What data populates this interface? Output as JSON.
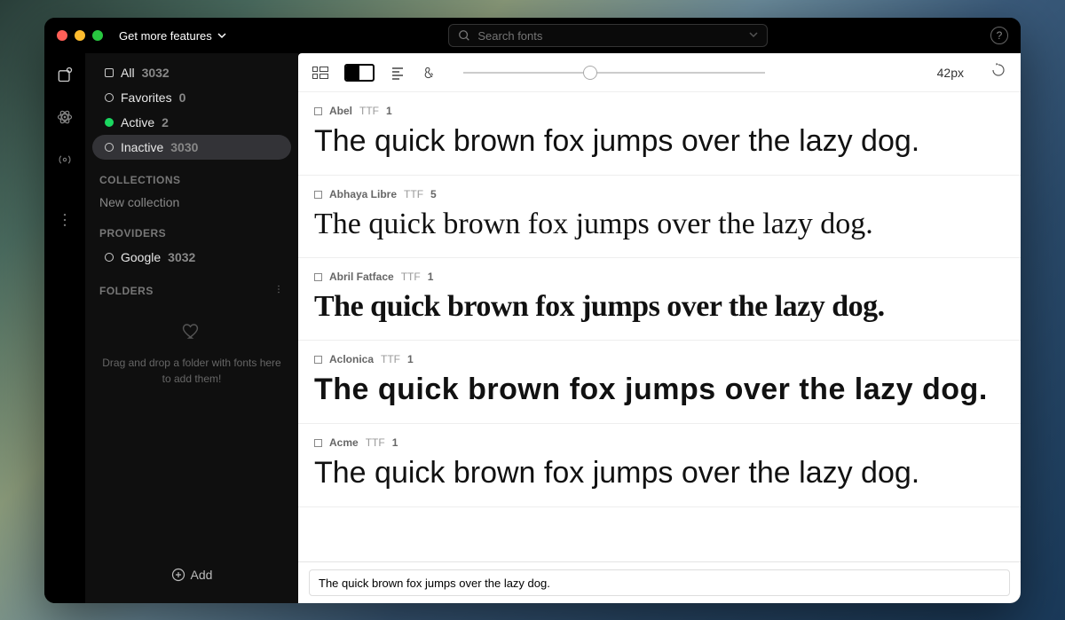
{
  "titlebar": {
    "features_label": "Get more features",
    "search_placeholder": "Search fonts"
  },
  "sidebar": {
    "filters": [
      {
        "icon": "square",
        "label": "All",
        "count": "3032",
        "selected": false
      },
      {
        "icon": "ring",
        "label": "Favorites",
        "count": "0",
        "selected": false
      },
      {
        "icon": "green",
        "label": "Active",
        "count": "2",
        "selected": false
      },
      {
        "icon": "ring",
        "label": "Inactive",
        "count": "3030",
        "selected": true
      }
    ],
    "collections_header": "COLLECTIONS",
    "collections_new": "New collection",
    "providers_header": "PROVIDERS",
    "providers": [
      {
        "icon": "ring",
        "label": "Google",
        "count": "3032"
      }
    ],
    "folders_header": "FOLDERS",
    "dropzone_text": "Drag and drop a folder with fonts here to add them!",
    "add_label": "Add"
  },
  "toolbar": {
    "size_label": "42px"
  },
  "preview_text": "The quick brown fox jumps over the lazy dog.",
  "preview_text_truncated": "The quick brown fox jumps over the la",
  "fonts": [
    {
      "name": "Abel",
      "ext": "TTF",
      "count": "1",
      "style": "sans"
    },
    {
      "name": "Abhaya Libre",
      "ext": "TTF",
      "count": "5",
      "style": "serif"
    },
    {
      "name": "Abril Fatface",
      "ext": "TTF",
      "count": "1",
      "style": "fat"
    },
    {
      "name": "Aclonica",
      "ext": "TTF",
      "count": "1",
      "style": "wide"
    },
    {
      "name": "Acme",
      "ext": "TTF",
      "count": "1",
      "style": "sans"
    }
  ],
  "input_value": "The quick brown fox jumps over the lazy dog."
}
